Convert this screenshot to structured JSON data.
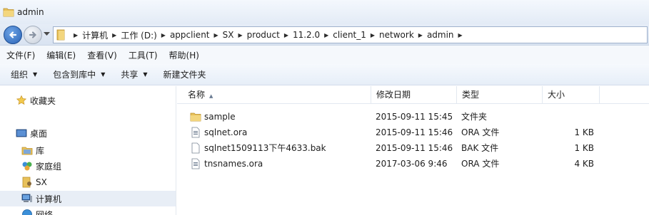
{
  "window": {
    "title": "admin"
  },
  "address": {
    "crumbs": [
      "计算机",
      "工作 (D:)",
      "appclient",
      "SX",
      "product",
      "11.2.0",
      "client_1",
      "network",
      "admin"
    ]
  },
  "menu": [
    "文件(F)",
    "编辑(E)",
    "查看(V)",
    "工具(T)",
    "帮助(H)"
  ],
  "toolbar": {
    "organize": "组织",
    "include_in_library": "包含到库中",
    "share": "共享",
    "new_folder": "新建文件夹"
  },
  "nav": {
    "favorites": "收藏夹",
    "desktop": "桌面",
    "library": "库",
    "homegroup": "家庭组",
    "sx": "SX",
    "computer": "计算机",
    "network": "网络"
  },
  "columns": {
    "name": "名称",
    "date": "修改日期",
    "type": "类型",
    "size": "大小"
  },
  "files": [
    {
      "name": "sample",
      "date": "2015-09-11 15:45",
      "type": "文件夹",
      "size": "",
      "icon": "folder-icon"
    },
    {
      "name": "sqlnet.ora",
      "date": "2015-09-11 15:46",
      "type": "ORA 文件",
      "size": "1 KB",
      "icon": "ora-file-icon"
    },
    {
      "name": "sqlnet1509113下午4633.bak",
      "date": "2015-09-11 15:46",
      "type": "BAK 文件",
      "size": "1 KB",
      "icon": "blank-file-icon"
    },
    {
      "name": "tnsnames.ora",
      "date": "2017-03-06 9:46",
      "type": "ORA 文件",
      "size": "4 KB",
      "icon": "ora-file-icon"
    }
  ],
  "colors": {
    "folder": "#e8c15a",
    "selection": "#e8eef6",
    "accent": "#2a63b5"
  }
}
